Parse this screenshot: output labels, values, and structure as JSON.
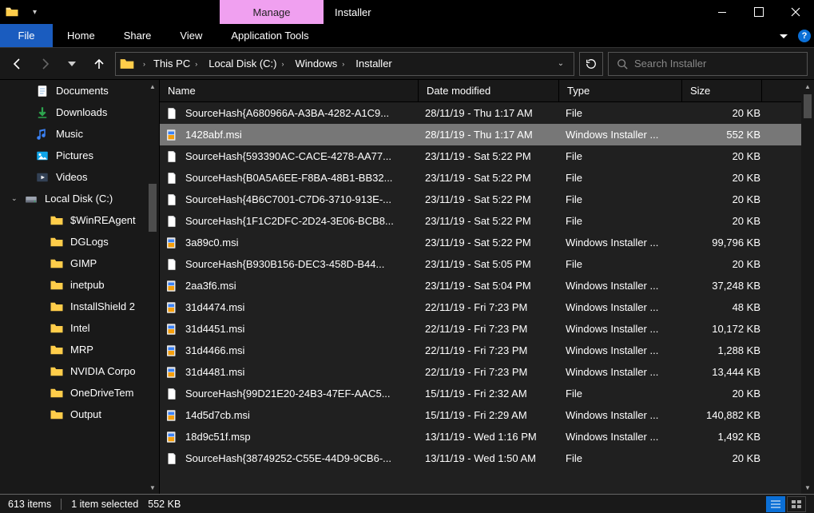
{
  "window": {
    "title": "Installer",
    "context_tab": "Manage"
  },
  "ribbon": {
    "file": "File",
    "tabs": [
      "Home",
      "Share",
      "View"
    ],
    "context_tab": "Application Tools"
  },
  "address": {
    "crumbs": [
      "This PC",
      "Local Disk (C:)",
      "Windows",
      "Installer"
    ]
  },
  "search": {
    "placeholder": "Search Installer"
  },
  "navpane": {
    "items": [
      {
        "label": "Documents",
        "icon": "doc"
      },
      {
        "label": "Downloads",
        "icon": "down"
      },
      {
        "label": "Music",
        "icon": "music"
      },
      {
        "label": "Pictures",
        "icon": "pic"
      },
      {
        "label": "Videos",
        "icon": "vid"
      }
    ],
    "drive": {
      "label": "Local Disk (C:)"
    },
    "subfolders": [
      "$WinREAgent",
      "DGLogs",
      "GIMP",
      "inetpub",
      "InstallShield 2",
      "Intel",
      "MRP",
      "NVIDIA Corpo",
      "OneDriveTem",
      "Output"
    ]
  },
  "columns": {
    "name": "Name",
    "date": "Date modified",
    "type": "Type",
    "size": "Size"
  },
  "files": [
    {
      "name": "SourceHash{A680966A-A3BA-4282-A1C9...",
      "date": "28/11/19 - Thu 1:17 AM",
      "type": "File",
      "size": "20 KB",
      "icon": "file"
    },
    {
      "name": "1428abf.msi",
      "date": "28/11/19 - Thu 1:17 AM",
      "type": "Windows Installer ...",
      "size": "552 KB",
      "icon": "msi",
      "selected": true
    },
    {
      "name": "SourceHash{593390AC-CACE-4278-AA77...",
      "date": "23/11/19 - Sat 5:22 PM",
      "type": "File",
      "size": "20 KB",
      "icon": "file"
    },
    {
      "name": "SourceHash{B0A5A6EE-F8BA-48B1-BB32...",
      "date": "23/11/19 - Sat 5:22 PM",
      "type": "File",
      "size": "20 KB",
      "icon": "file"
    },
    {
      "name": "SourceHash{4B6C7001-C7D6-3710-913E-...",
      "date": "23/11/19 - Sat 5:22 PM",
      "type": "File",
      "size": "20 KB",
      "icon": "file"
    },
    {
      "name": "SourceHash{1F1C2DFC-2D24-3E06-BCB8...",
      "date": "23/11/19 - Sat 5:22 PM",
      "type": "File",
      "size": "20 KB",
      "icon": "file"
    },
    {
      "name": "3a89c0.msi",
      "date": "23/11/19 - Sat 5:22 PM",
      "type": "Windows Installer ...",
      "size": "99,796 KB",
      "icon": "msi"
    },
    {
      "name": "SourceHash{B930B156-DEC3-458D-B44...",
      "date": "23/11/19 - Sat 5:05 PM",
      "type": "File",
      "size": "20 KB",
      "icon": "file"
    },
    {
      "name": "2aa3f6.msi",
      "date": "23/11/19 - Sat 5:04 PM",
      "type": "Windows Installer ...",
      "size": "37,248 KB",
      "icon": "msi"
    },
    {
      "name": "31d4474.msi",
      "date": "22/11/19 - Fri 7:23 PM",
      "type": "Windows Installer ...",
      "size": "48 KB",
      "icon": "msi"
    },
    {
      "name": "31d4451.msi",
      "date": "22/11/19 - Fri 7:23 PM",
      "type": "Windows Installer ...",
      "size": "10,172 KB",
      "icon": "msi"
    },
    {
      "name": "31d4466.msi",
      "date": "22/11/19 - Fri 7:23 PM",
      "type": "Windows Installer ...",
      "size": "1,288 KB",
      "icon": "msi"
    },
    {
      "name": "31d4481.msi",
      "date": "22/11/19 - Fri 7:23 PM",
      "type": "Windows Installer ...",
      "size": "13,444 KB",
      "icon": "msi"
    },
    {
      "name": "SourceHash{99D21E20-24B3-47EF-AAC5...",
      "date": "15/11/19 - Fri 2:32 AM",
      "type": "File",
      "size": "20 KB",
      "icon": "file"
    },
    {
      "name": "14d5d7cb.msi",
      "date": "15/11/19 - Fri 2:29 AM",
      "type": "Windows Installer ...",
      "size": "140,882 KB",
      "icon": "msi"
    },
    {
      "name": "18d9c51f.msp",
      "date": "13/11/19 - Wed 1:16 PM",
      "type": "Windows Installer ...",
      "size": "1,492 KB",
      "icon": "msi"
    },
    {
      "name": "SourceHash{38749252-C55E-44D9-9CB6-...",
      "date": "13/11/19 - Wed 1:50 AM",
      "type": "File",
      "size": "20 KB",
      "icon": "file"
    }
  ],
  "status": {
    "count": "613 items",
    "selection": "1 item selected",
    "size": "552 KB"
  }
}
